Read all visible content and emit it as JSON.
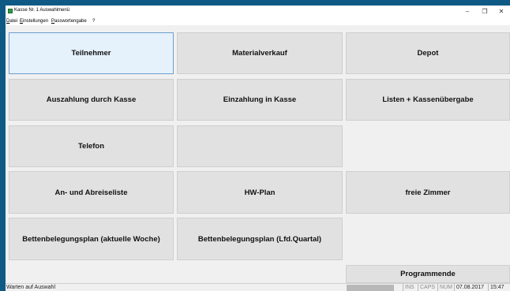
{
  "window": {
    "title": "Kasse Nr. 1 Auswahlmenü",
    "controls": {
      "minimize": "–",
      "maximize": "❐",
      "close": "✕"
    }
  },
  "menu": {
    "datei": {
      "accel": "D",
      "rest": "atei"
    },
    "einstellungen": {
      "accel": "E",
      "rest": "instellungen"
    },
    "passwort": {
      "accel": "P",
      "rest": "asswortengabe"
    },
    "help": "?"
  },
  "buttons": {
    "teilnehmer": "Teilnehmer",
    "materialverkauf": "Materialverkauf",
    "depot": "Depot",
    "auszahlung": "Auszahlung durch Kasse",
    "einzahlung": "Einzahlung in Kasse",
    "listen": "Listen + Kassenübergabe",
    "telefon": "Telefon",
    "empty": "",
    "anabreise": "An- und Abreiseliste",
    "hwplan": "HW-Plan",
    "zimmer": "freie Zimmer",
    "bettenplan_woche": "Bettenbelegungsplan (aktuelle Woche)",
    "bettenplan_quartal": "Bettenbelegungsplan (Lfd.Quartal)",
    "programmende": "Programmende"
  },
  "status": {
    "message": "Warten auf Auswahl",
    "ins": "INS",
    "caps": "CAPS",
    "num": "NUM",
    "date": "07.08.2017",
    "time": "15:47"
  },
  "colors": {
    "desktop": "#0f5a85",
    "window_bg": "#f0f0f0",
    "button_bg": "#e1e1e1",
    "selected_bg": "#e5f1fb",
    "selected_border": "#6d9fcc",
    "app_icon": "#2d9b47"
  }
}
